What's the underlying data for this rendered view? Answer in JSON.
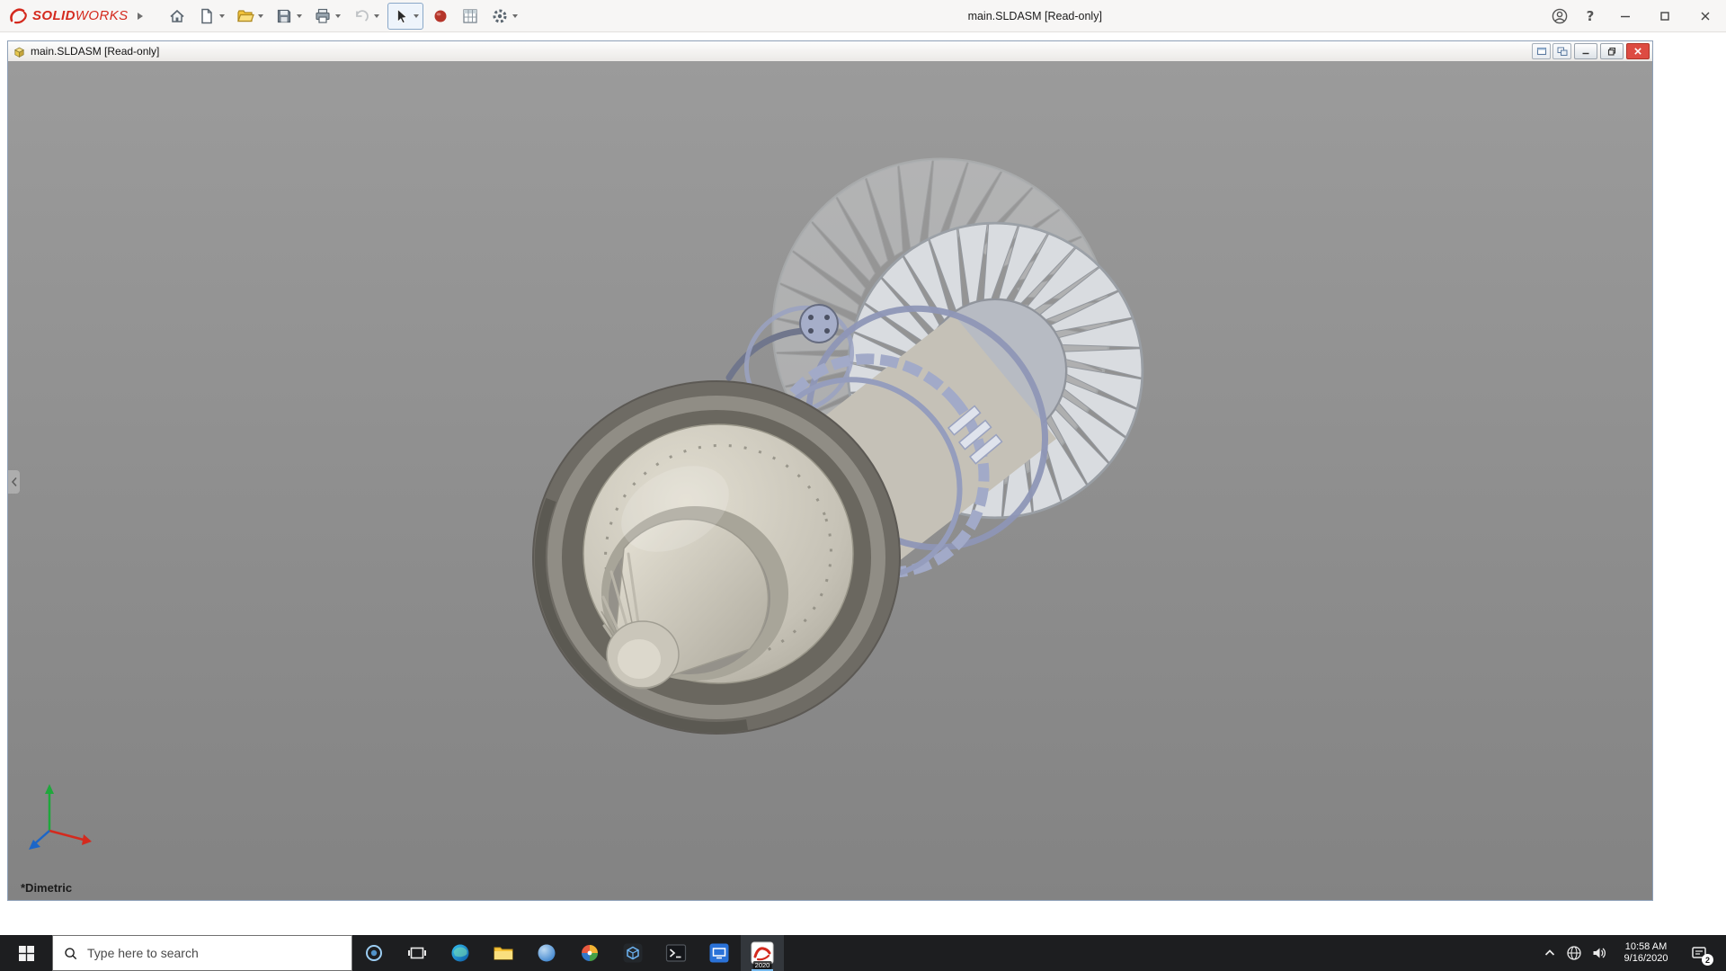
{
  "window": {
    "title": "main.SLDASM [Read-only]"
  },
  "brand": {
    "bold": "SOLID",
    "light": "WORKS"
  },
  "document": {
    "title": "main.SLDASM [Read-only]",
    "orientation": "*Dimetric"
  },
  "taskbar": {
    "search_placeholder": "Type here to search",
    "sw_year": "2020",
    "clock": {
      "time": "10:58 AM",
      "date": "9/16/2020"
    },
    "badge_count": "2"
  },
  "icons": {
    "help_glyph": "?",
    "toolbar": [
      "home-icon",
      "new-document-icon",
      "open-icon",
      "save-icon",
      "print-icon",
      "undo-icon",
      "select-cursor-icon",
      "appearance-icon",
      "design-table-icon",
      "options-gear-icon"
    ],
    "titlebar_right": [
      "account-icon",
      "help-icon",
      "minimize-icon",
      "maximize-icon",
      "close-icon"
    ],
    "doc_titlebar": [
      "assembly-icon",
      "doc-window-icon-1",
      "doc-window-icon-2",
      "minimize-icon",
      "restore-icon",
      "close-icon"
    ],
    "taskbar": [
      "start-icon",
      "search-icon",
      "cortana-icon",
      "task-view-icon",
      "edge-icon",
      "file-explorer-icon",
      "browser-icon",
      "photos-app-icon",
      "cube-app-icon",
      "terminal-icon",
      "blue-app-icon",
      "solidworks-icon",
      "tray-chevron-icon",
      "network-globe-icon",
      "volume-icon",
      "action-center-icon"
    ]
  },
  "colors": {
    "brand_red": "#d42a1e",
    "close_red": "#dd4b42",
    "accent_blue": "#76b9ed",
    "taskbar_bg": "#1d1e20",
    "viewport_gray": "#8f8f8f",
    "model_beige": "#cfcbbf",
    "model_lavender": "#a2aac8",
    "model_dark_ring": "#6e6b64"
  }
}
